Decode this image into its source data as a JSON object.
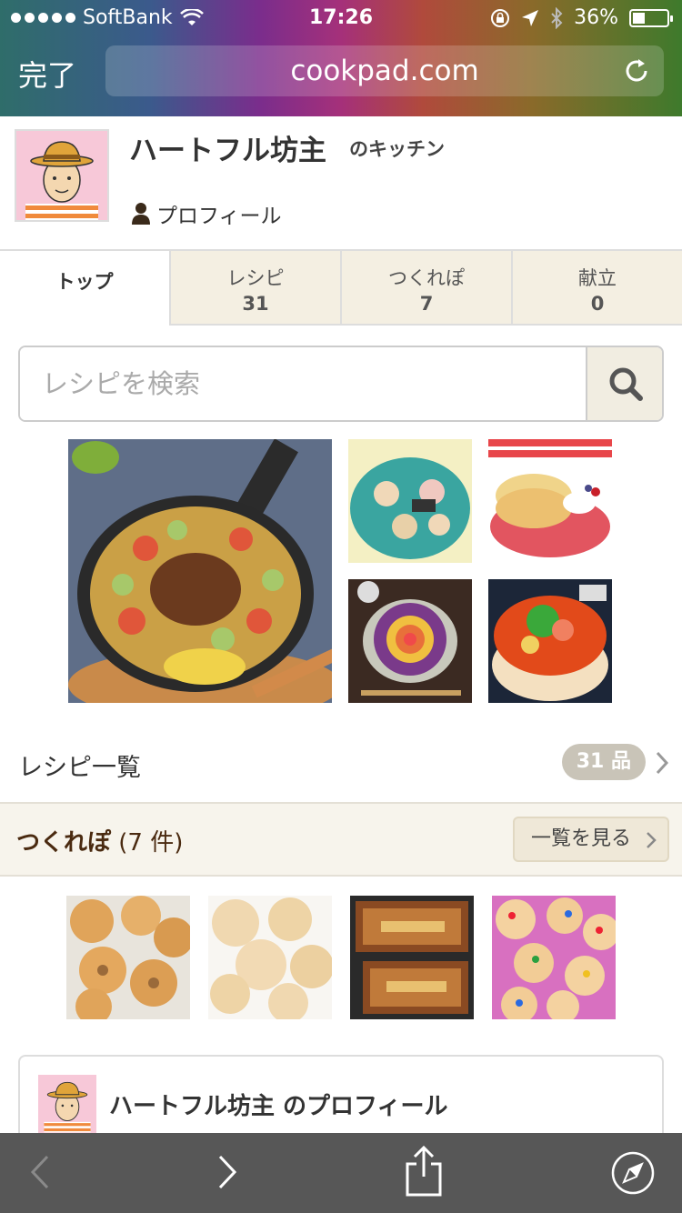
{
  "status_bar": {
    "carrier": "SoftBank",
    "time": "17:26",
    "battery_percent": "36%",
    "battery_level": 0.36,
    "signal_bars": 5
  },
  "browser": {
    "done_label": "完了",
    "url": "cookpad.com",
    "reload_icon": "reload-icon"
  },
  "kitchen": {
    "name": "ハートフル坊主",
    "suffix": "のキッチン",
    "profile_label": "プロフィール"
  },
  "tabs": [
    {
      "label": "トップ",
      "count": ""
    },
    {
      "label": "レシピ",
      "count": "31"
    },
    {
      "label": "つくれぽ",
      "count": "7"
    },
    {
      "label": "献立",
      "count": "0"
    }
  ],
  "search": {
    "placeholder": "レシピを検索",
    "value": ""
  },
  "recipe_list": {
    "label": "レシピ一覧",
    "count": "31 品"
  },
  "tsukurepo": {
    "title": "つくれぽ",
    "count": "(7 件)",
    "see_all": "一覧を見る"
  },
  "profile_card": {
    "title": "ハートフル坊主 のプロフィール"
  },
  "colors": {
    "tab_bg": "#f4efe2",
    "accent_brown": "#4a2a10",
    "pill_gray": "#c9c4b8",
    "toolbar": "#575757"
  }
}
